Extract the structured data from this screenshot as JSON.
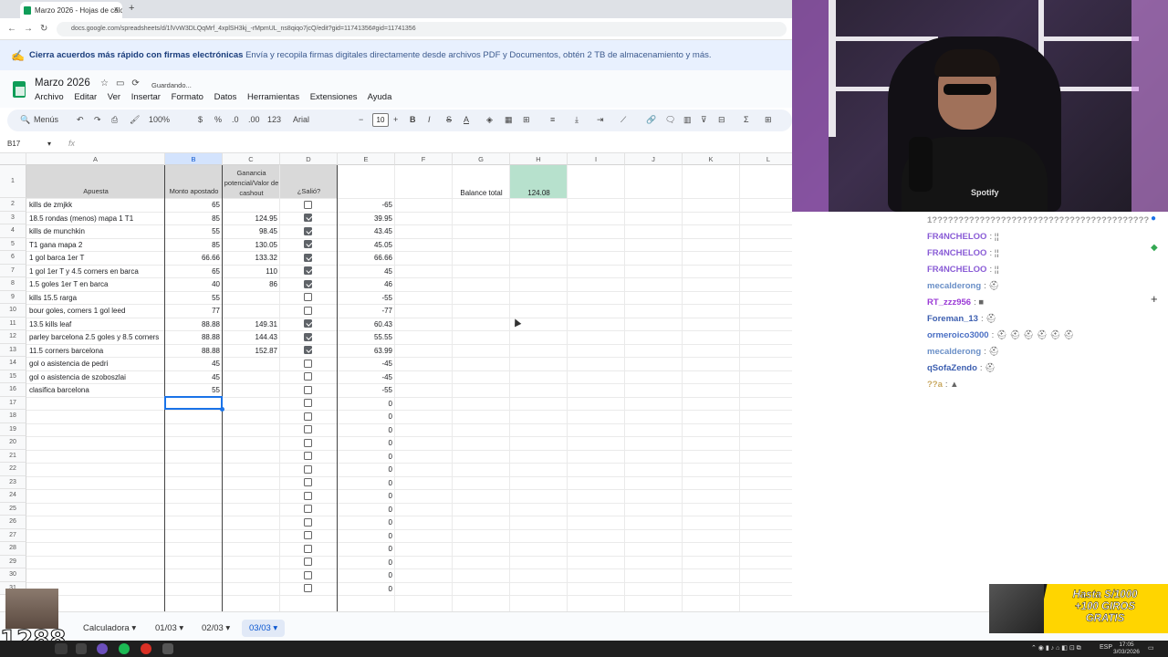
{
  "browser": {
    "tab_title": "Marzo 2026 - Hojas de cálculo",
    "close_glyph": "×",
    "newtab_glyph": "+",
    "back_glyph": "←",
    "forward_glyph": "→",
    "reload_glyph": "↻",
    "url": "docs.google.com/spreadsheets/d/1lVvW3DLQqMrf_4xplSH3kj_-rMpmUL_ns8qiqo7jcQ/edit?gid=11741356#gid=11741356"
  },
  "promo": {
    "icon": "signature-icon",
    "bold": "Cierra acuerdos más rápido con firmas electrónicas",
    "rest": "Envía y recopila firmas digitales directamente desde archivos PDF y Documentos, obtén 2 TB de almacenamiento y más."
  },
  "sheets": {
    "title": "Marzo 2026",
    "status": "Guardando...",
    "menu": [
      "Archivo",
      "Editar",
      "Ver",
      "Insertar",
      "Formato",
      "Datos",
      "Herramientas",
      "Extensiones",
      "Ayuda"
    ]
  },
  "toolbar": {
    "menus_label": "Menús",
    "zoom": "100%",
    "currency": "$",
    "percent": "%",
    "dec_down": ".0",
    "dec_up": ".00",
    "number_format": "123",
    "font": "Arial",
    "font_size": "10",
    "minus": "−",
    "plus": "+",
    "bold": "B",
    "italic": "I",
    "strike": "S",
    "text_color": "A",
    "sum": "Σ"
  },
  "formula_bar": {
    "name_box": "B17",
    "fx": "fx"
  },
  "grid": {
    "columns": [
      "A",
      "B",
      "C",
      "D",
      "E",
      "F",
      "G",
      "H",
      "I",
      "J",
      "K",
      "L"
    ],
    "headers": {
      "A": "Apuesta",
      "B": "Monto apostado",
      "C": "Ganancia potencial/Valor de cashout",
      "D": "¿Salió?"
    },
    "balance_label": "Balance total",
    "balance_value": "124.08",
    "rows": [
      {
        "n": "2",
        "a": "kills de zmjkk",
        "b": "65",
        "c": "",
        "d": false,
        "e": "-65"
      },
      {
        "n": "3",
        "a": "18.5 rondas (menos) mapa 1 T1",
        "b": "85",
        "c": "124.95",
        "d": true,
        "e": "39.95"
      },
      {
        "n": "4",
        "a": "kills de munchkin",
        "b": "55",
        "c": "98.45",
        "d": true,
        "e": "43.45"
      },
      {
        "n": "5",
        "a": "T1 gana mapa 2",
        "b": "85",
        "c": "130.05",
        "d": true,
        "e": "45.05"
      },
      {
        "n": "6",
        "a": "1 gol barca 1er T",
        "b": "66.66",
        "c": "133.32",
        "d": true,
        "e": "66.66"
      },
      {
        "n": "7",
        "a": "1 gol 1er T y 4.5 corners en barca",
        "b": "65",
        "c": "110",
        "d": true,
        "e": "45"
      },
      {
        "n": "8",
        "a": "1.5 goles 1er T en barca",
        "b": "40",
        "c": "86",
        "d": true,
        "e": "46"
      },
      {
        "n": "9",
        "a": "kills 15.5 rarga",
        "b": "55",
        "c": "",
        "d": false,
        "e": "-55"
      },
      {
        "n": "10",
        "a": "bour goles, corners 1 gol leed",
        "b": "77",
        "c": "",
        "d": false,
        "e": "-77"
      },
      {
        "n": "11",
        "a": "13.5 kills leaf",
        "b": "88.88",
        "c": "149.31",
        "d": true,
        "e": "60.43"
      },
      {
        "n": "12",
        "a": "parley barcelona 2.5 goles y 8.5 corners",
        "b": "88.88",
        "c": "144.43",
        "d": true,
        "e": "55.55"
      },
      {
        "n": "13",
        "a": "11.5 corners barcelona",
        "b": "88.88",
        "c": "152.87",
        "d": true,
        "e": "63.99"
      },
      {
        "n": "14",
        "a": "gol o asistencia de pedri",
        "b": "45",
        "c": "",
        "d": false,
        "e": "-45"
      },
      {
        "n": "15",
        "a": "gol o asistencia de szoboszlai",
        "b": "45",
        "c": "",
        "d": false,
        "e": "-45"
      },
      {
        "n": "16",
        "a": "clasifica barcelona",
        "b": "55",
        "c": "",
        "d": false,
        "e": "-55"
      },
      {
        "n": "17",
        "a": "",
        "b": "",
        "c": "",
        "d": false,
        "e": "0"
      },
      {
        "n": "18",
        "a": "",
        "b": "",
        "c": "",
        "d": false,
        "e": "0"
      },
      {
        "n": "19",
        "a": "",
        "b": "",
        "c": "",
        "d": false,
        "e": "0"
      },
      {
        "n": "20",
        "a": "",
        "b": "",
        "c": "",
        "d": false,
        "e": "0"
      },
      {
        "n": "21",
        "a": "",
        "b": "",
        "c": "",
        "d": false,
        "e": "0"
      },
      {
        "n": "22",
        "a": "",
        "b": "",
        "c": "",
        "d": false,
        "e": "0"
      },
      {
        "n": "23",
        "a": "",
        "b": "",
        "c": "",
        "d": false,
        "e": "0"
      },
      {
        "n": "24",
        "a": "",
        "b": "",
        "c": "",
        "d": false,
        "e": "0"
      },
      {
        "n": "25",
        "a": "",
        "b": "",
        "c": "",
        "d": false,
        "e": "0"
      },
      {
        "n": "26",
        "a": "",
        "b": "",
        "c": "",
        "d": false,
        "e": "0"
      },
      {
        "n": "27",
        "a": "",
        "b": "",
        "c": "",
        "d": false,
        "e": "0"
      },
      {
        "n": "28",
        "a": "",
        "b": "",
        "c": "",
        "d": false,
        "e": "0"
      },
      {
        "n": "29",
        "a": "",
        "b": "",
        "c": "",
        "d": false,
        "e": "0"
      },
      {
        "n": "30",
        "a": "",
        "b": "",
        "c": "",
        "d": false,
        "e": "0"
      },
      {
        "n": "31",
        "a": "",
        "b": "",
        "c": "",
        "d": false,
        "e": "0"
      }
    ]
  },
  "sheet_tabs": [
    "Calculadora",
    "01/03",
    "02/03",
    "03/03"
  ],
  "active_sheet": "03/03",
  "chat": [
    {
      "user": "1?????????????????????????????????????????",
      "msg": "",
      "color": "#9a9a9a"
    },
    {
      "user": "FR4NCHELOO",
      "msg": ": ¦¦",
      "color": "#8a5cd6"
    },
    {
      "user": "FR4NCHELOO",
      "msg": ": ¦¦",
      "color": "#8a5cd6"
    },
    {
      "user": "FR4NCHELOO",
      "msg": ": ¦¦",
      "color": "#8a5cd6"
    },
    {
      "user": "mecalderong",
      "msg": ": ⛑",
      "color": "#6a8fc7"
    },
    {
      "user": "RT_zzz956",
      "msg": ": ■",
      "color": "#9b3bd6"
    },
    {
      "user": "Foreman_13",
      "msg": ": ⛑",
      "color": "#3d5fb0"
    },
    {
      "user": "ormeroico3000",
      "msg": ": ⛑ ⛑ ⛑ ⛑ ⛑ ⛑",
      "color": "#4a6fc4"
    },
    {
      "user": "mecalderong",
      "msg": ": ⛑",
      "color": "#6a8fc7"
    },
    {
      "user": "qSofaZendo",
      "msg": ": ⛑",
      "color": "#3d5fb0"
    },
    {
      "user": "??a",
      "msg": ": ▲",
      "color": "#c9a860"
    }
  ],
  "overlay": {
    "counter": "1288",
    "ad_line1": "Hasta S/1000",
    "ad_line2": "+100 GIROS",
    "ad_line3": "GRATIS",
    "webcam_brand": "Spotify"
  },
  "taskbar": {
    "lang": "ESP",
    "time": "17:05",
    "date": "3/03/2026"
  },
  "colors": {
    "balance_fill": "#b7e1cd",
    "promo_bg": "#e8f0fe",
    "selection": "#1a73e8",
    "header_fill": "#d9d9d9"
  }
}
